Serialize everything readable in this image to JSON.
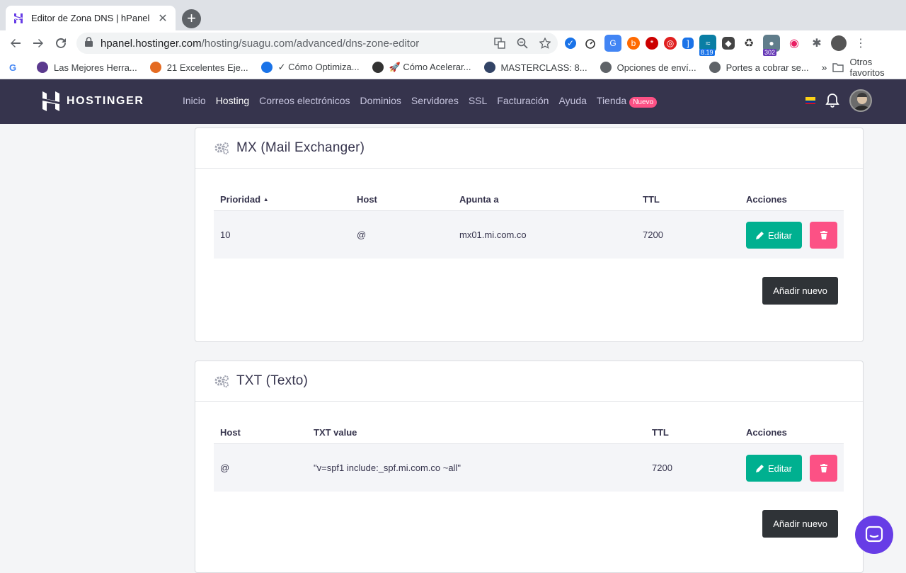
{
  "browser": {
    "tab_title": "Editor de Zona DNS | hPanel",
    "tab_close": "✕",
    "newtab": "+",
    "url_host": "hpanel.hostinger.com",
    "url_path": "/hosting/suagu.com/advanced/dns-zone-editor",
    "extension_badges": [
      "8.19",
      "302"
    ],
    "bookmarks": [
      {
        "label": "Las Mejores Herra...",
        "color": "#5b3a8e"
      },
      {
        "label": "21 Excelentes Eje...",
        "color": "#e46b22"
      },
      {
        "label": "✓ Cómo Optimiza...",
        "color": "#1a73e8"
      },
      {
        "label": "🚀 Cómo Acelerar...",
        "color": "#333333"
      },
      {
        "label": "MASTERCLASS: 8...",
        "color": "#334466"
      },
      {
        "label": "Opciones de enví...",
        "color": "#5f6368"
      },
      {
        "label": "Portes a cobrar se...",
        "color": "#5f6368"
      }
    ],
    "bookmarks_more": "»",
    "other_bookmarks": "Otros favoritos"
  },
  "header": {
    "logo": "HOSTINGER",
    "nav": [
      {
        "label": "Inicio",
        "active": false
      },
      {
        "label": "Hosting",
        "active": true
      },
      {
        "label": "Correos electrónicos",
        "active": false
      },
      {
        "label": "Dominios",
        "active": false
      },
      {
        "label": "Servidores",
        "active": false
      },
      {
        "label": "SSL",
        "active": false
      },
      {
        "label": "Facturación",
        "active": false
      },
      {
        "label": "Ayuda",
        "active": false
      },
      {
        "label": "Tienda",
        "active": false
      }
    ],
    "new_badge": "Nuevo"
  },
  "mx": {
    "title": "MX (Mail Exchanger)",
    "columns": [
      "Prioridad",
      "Host",
      "Apunta a",
      "TTL",
      "Acciones"
    ],
    "sort_indicator": "▲",
    "rows": [
      {
        "priority": "10",
        "host": "@",
        "points_to": "mx01.mi.com.co",
        "ttl": "7200"
      }
    ],
    "edit_label": "Editar",
    "add_label": "Añadir nuevo"
  },
  "txt": {
    "title": "TXT (Texto)",
    "columns": [
      "Host",
      "TXT value",
      "TTL",
      "Acciones"
    ],
    "rows": [
      {
        "host": "@",
        "value": "\"v=spf1 include:_spf.mi.com.co ~all\"",
        "ttl": "7200"
      }
    ],
    "edit_label": "Editar",
    "add_label": "Añadir nuevo"
  },
  "colors": {
    "header_bg": "#36344d",
    "edit_btn": "#00b090",
    "delete_btn": "#fc5185",
    "add_btn": "#2f3337",
    "chat": "#673de6"
  }
}
